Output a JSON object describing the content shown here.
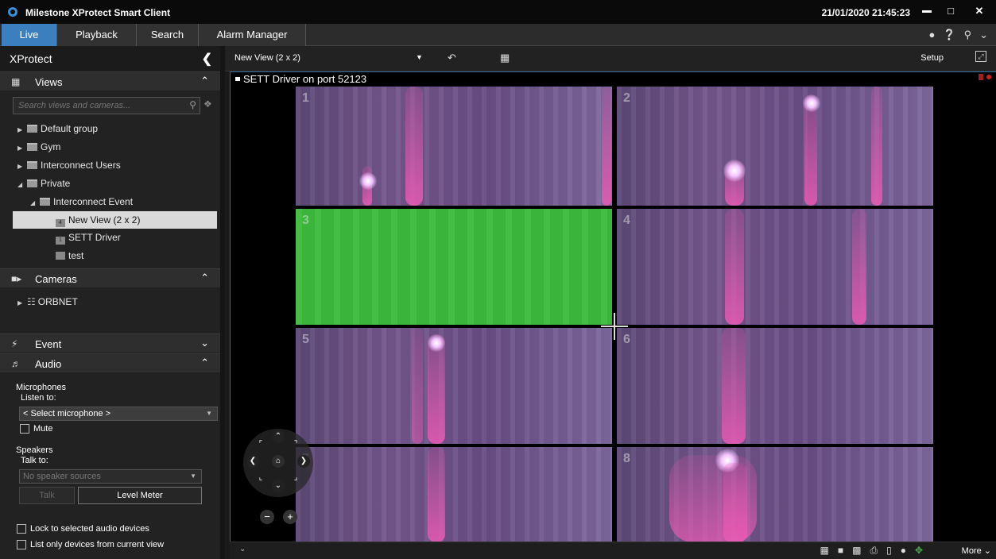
{
  "app": {
    "title": "Milestone XProtect Smart Client",
    "clock": "21/01/2020 21:45:23"
  },
  "tabs": [
    "Live",
    "Playback",
    "Search",
    "Alarm Manager"
  ],
  "sidebar": {
    "title": "XProtect",
    "views_label": "Views",
    "search_placeholder": "Search views and cameras...",
    "tree": {
      "default_group": "Default group",
      "gym": "Gym",
      "interconnect_users": "Interconnect Users",
      "private": "Private",
      "interconnect_event": "Interconnect Event",
      "new_view": "New View (2 x 2)",
      "sett_driver": "SETT Driver",
      "test": "test"
    },
    "view_icon_nums": {
      "new_view": "4",
      "sett_driver": "1"
    },
    "cameras_label": "Cameras",
    "orbnet": "ORBNET",
    "event_label": "Event",
    "audio_label": "Audio",
    "audio": {
      "microphones": "Microphones",
      "listen_to": "Listen to:",
      "select_mic": "< Select microphone >",
      "mute": "Mute",
      "speakers": "Speakers",
      "talk_to": "Talk to:",
      "no_speakers": "No speaker sources",
      "talk": "Talk",
      "level_meter": "Level Meter",
      "lock_devices": "Lock to selected audio devices",
      "list_only": "List only devices from current view"
    }
  },
  "toolbar": {
    "view_name": "New View (2 x 2)",
    "setup": "Setup"
  },
  "viewport": {
    "camera_title": "SETT Driver on port 52123",
    "cell_numbers": [
      "1",
      "2",
      "3",
      "4",
      "5",
      "6",
      "7",
      "8"
    ]
  },
  "bottombar": {
    "more": "More"
  },
  "colors": {
    "accent": "#3b7fbf",
    "highlight_cell": "#3cba3c",
    "rec": "#d02020"
  }
}
